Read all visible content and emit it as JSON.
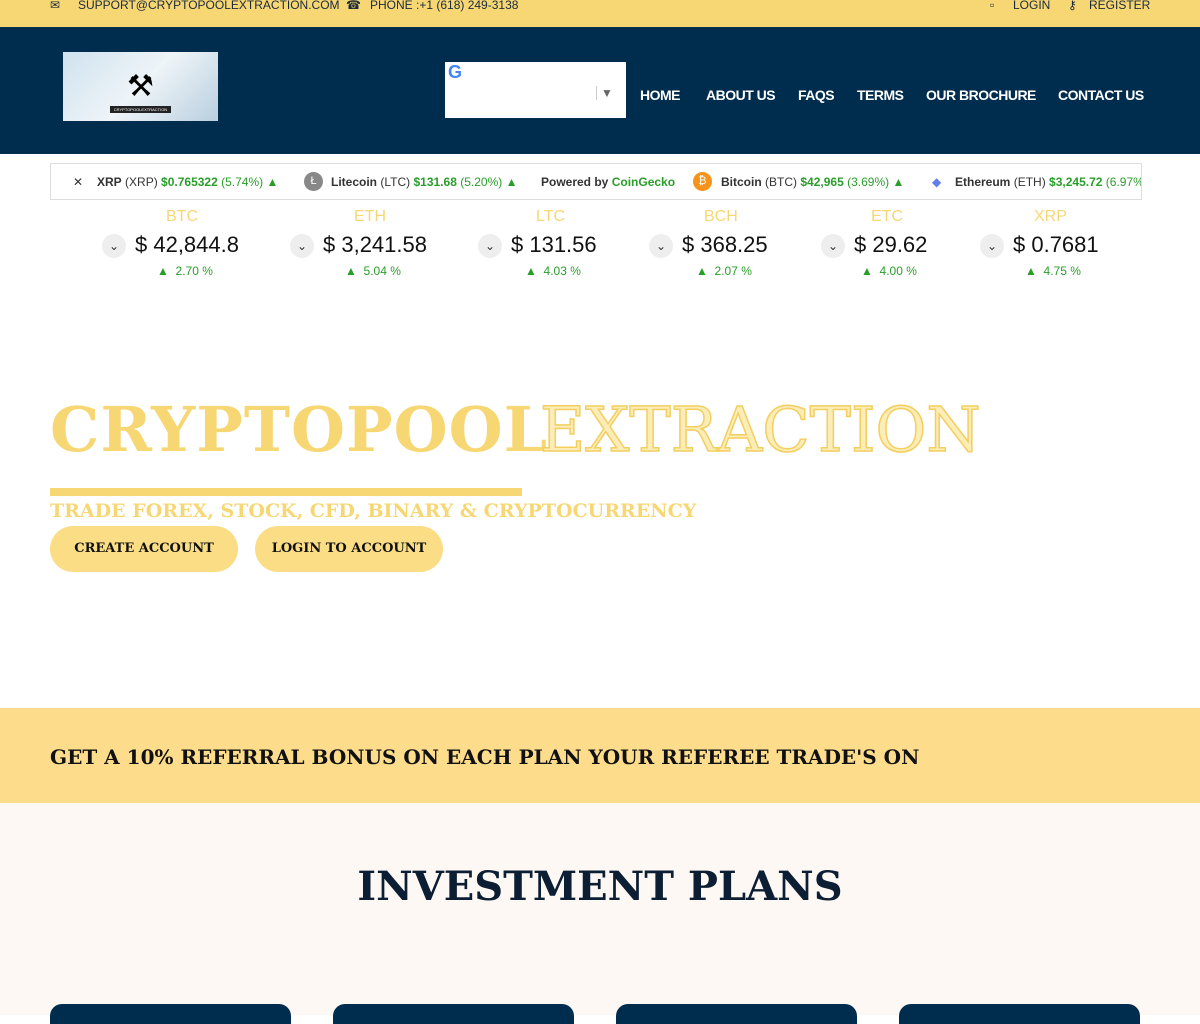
{
  "topbar": {
    "email": "SUPPORT@CRYPTOPOOLEXTRACTION.COM",
    "phone": "PHONE :+1 (618) 249-3138",
    "login": "LOGIN",
    "register": "REGISTER"
  },
  "logo_text": "CRYPTOPOOLEXTRACTION",
  "nav": {
    "items": [
      "HOME",
      "ABOUT US",
      "FAQS",
      "TERMS",
      "OUR BROCHURE",
      "CONTACT US"
    ]
  },
  "ticker": [
    {
      "name": "XRP",
      "sym": "(XRP)",
      "price": "$0.765322",
      "chg": "(5.74%)"
    },
    {
      "name": "Litecoin",
      "sym": "(LTC)",
      "price": "$131.68",
      "chg": "(5.20%)"
    },
    {
      "powered": "Powered by",
      "brand": "CoinGecko"
    },
    {
      "name": "Bitcoin",
      "sym": "(BTC)",
      "price": "$42,965",
      "chg": "(3.69%)"
    },
    {
      "name": "Ethereum",
      "sym": "(ETH)",
      "price": "$3,245.72",
      "chg": "(6.97%"
    }
  ],
  "coins": [
    {
      "sym": "BTC",
      "price": "$ 42,844.8",
      "pct": "2.70 %"
    },
    {
      "sym": "ETH",
      "price": "$ 3,241.58",
      "pct": "5.04 %"
    },
    {
      "sym": "LTC",
      "price": "$ 131.56",
      "pct": "4.03 %"
    },
    {
      "sym": "BCH",
      "price": "$ 368.25",
      "pct": "2.07 %"
    },
    {
      "sym": "ETC",
      "price": "$ 29.62",
      "pct": "4.00 %"
    },
    {
      "sym": "XRP",
      "price": "$ 0.7681",
      "pct": "4.75 %"
    }
  ],
  "hero": {
    "title1": "CRYPTOPOOL",
    "title2": "EXTRACTION",
    "subtitle": "TRADE FOREX, STOCK, CFD, BINARY & CRYPTOCURRENCY",
    "create": "CREATE ACCOUNT",
    "login": "LOGIN TO ACCOUNT"
  },
  "referral": "GET A 10% REFERRAL BONUS ON EACH PLAN YOUR REFEREE TRADE'S ON",
  "plans_title": "INVESTMENT PLANS",
  "colors": {
    "accent": "#f7d774",
    "navy": "#002d4d",
    "green": "#2a9d2a"
  }
}
